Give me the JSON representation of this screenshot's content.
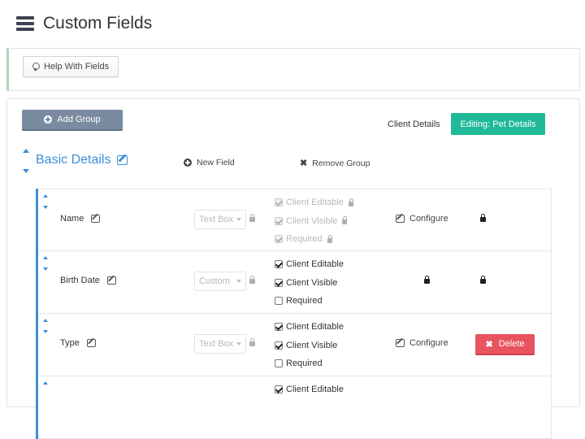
{
  "header": {
    "title": "Custom Fields",
    "icon": "server-icon"
  },
  "help": {
    "label": "Help With Fields",
    "icon": "lightbulb-icon"
  },
  "toolbar": {
    "add_group_label": "Add Group"
  },
  "tabs": [
    {
      "label": "Client Details",
      "active": false
    },
    {
      "label": "Editing: Pet Details",
      "active": true
    }
  ],
  "group": {
    "title": "Basic Details",
    "new_field_label": "New Field",
    "remove_group_label": "Remove Group"
  },
  "fields": [
    {
      "name": "Name",
      "type": "Text Box",
      "checks": [
        {
          "label": "Client Editable",
          "checked": true,
          "disabled": true
        },
        {
          "label": "Client Visible",
          "checked": true,
          "disabled": true
        },
        {
          "label": "Required",
          "checked": true,
          "disabled": true
        }
      ],
      "configure_label": "Configure",
      "action": "lock"
    },
    {
      "name": "Birth Date",
      "type": "Custom",
      "checks": [
        {
          "label": "Client Editable",
          "checked": true,
          "disabled": false
        },
        {
          "label": "Client Visible",
          "checked": true,
          "disabled": false
        },
        {
          "label": "Required",
          "checked": false,
          "disabled": false
        }
      ],
      "configure_label": "",
      "action": "lock"
    },
    {
      "name": "Type",
      "type": "Text Box",
      "checks": [
        {
          "label": "Client Editable",
          "checked": true,
          "disabled": false
        },
        {
          "label": "Client Visible",
          "checked": true,
          "disabled": false
        },
        {
          "label": "Required",
          "checked": false,
          "disabled": false
        }
      ],
      "configure_label": "Configure",
      "action": "delete",
      "delete_label": "Delete"
    },
    {
      "name": "",
      "type": "",
      "checks": [
        {
          "label": "Client Editable",
          "checked": true,
          "disabled": false
        }
      ],
      "configure_label": "",
      "action": ""
    }
  ],
  "colors": {
    "accent": "#3b8fd9",
    "active_tab": "#1fb997",
    "delete": "#e8545e",
    "add_group": "#7a8ba0"
  }
}
